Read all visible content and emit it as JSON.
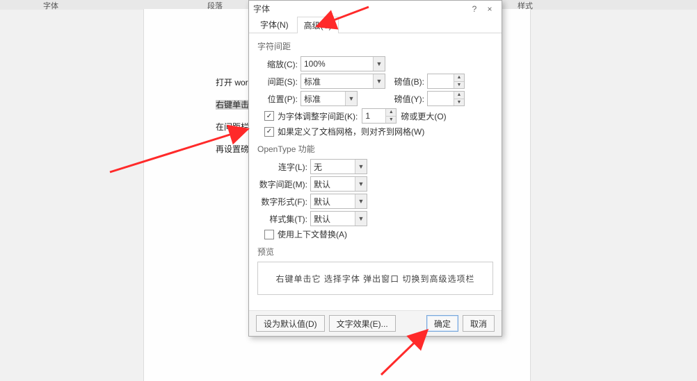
{
  "ribbon": {
    "font": "字体",
    "paragraph": "段落",
    "styles": "样式"
  },
  "doc": {
    "line1_prefix": "打开 wor",
    "line2_hl": "右键单击",
    "line3": "在间距栏",
    "line4": "再设置磅"
  },
  "dialog": {
    "title": "字体",
    "help": "?",
    "close": "×",
    "tabs": {
      "font": "字体(N)",
      "advanced": "高级(V)"
    },
    "section_spacing": "字符间距",
    "scale": {
      "label": "缩放(C):",
      "value": "100%"
    },
    "spacing": {
      "label": "间距(S):",
      "value": "标准",
      "amount_label": "磅值(B):",
      "amount": ""
    },
    "position": {
      "label": "位置(P):",
      "value": "标准",
      "amount_label": "磅值(Y):",
      "amount": ""
    },
    "kern": {
      "checked": true,
      "label_pre": "为字体调整字间距(K):",
      "value": "1",
      "label_post": "磅或更大(O)"
    },
    "grid": {
      "checked": true,
      "label": "如果定义了文档网格，则对齐到网格(W)"
    },
    "section_opentype": "OpenType 功能",
    "ligature": {
      "label": "连字(L):",
      "value": "无"
    },
    "numspacing": {
      "label": "数字间距(M):",
      "value": "默认"
    },
    "numform": {
      "label": "数字形式(F):",
      "value": "默认"
    },
    "styleset": {
      "label": "样式集(T):",
      "value": "默认"
    },
    "contextual": {
      "checked": false,
      "label": "使用上下文替换(A)"
    },
    "section_preview": "预览",
    "preview_text": "右键单击它 选择字体 弹出窗口 切换到高级选项栏",
    "buttons": {
      "default": "设为默认值(D)",
      "effects": "文字效果(E)...",
      "ok": "确定",
      "cancel": "取消"
    }
  }
}
